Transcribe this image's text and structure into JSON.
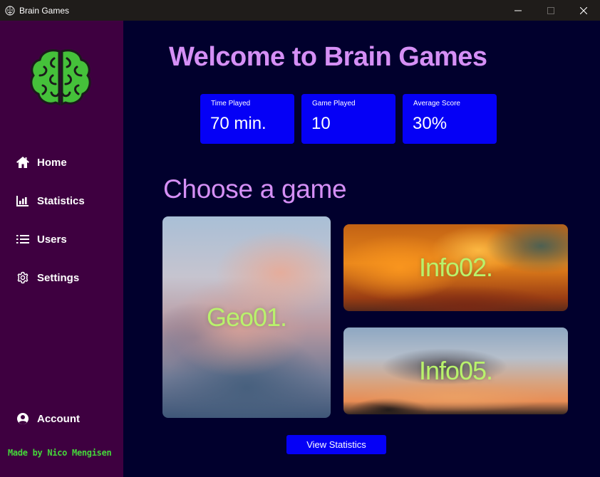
{
  "window": {
    "title": "Brain Games",
    "icons": {
      "app": "brain-app-icon",
      "minimize": "minimize-icon",
      "maximize": "maximize-icon",
      "close": "close-icon"
    }
  },
  "sidebar": {
    "logo": "brain-logo-icon",
    "items": [
      {
        "label": "Home",
        "icon": "home-icon"
      },
      {
        "label": "Statistics",
        "icon": "bar-chart-icon"
      },
      {
        "label": "Users",
        "icon": "list-icon"
      },
      {
        "label": "Settings",
        "icon": "gear-icon"
      }
    ],
    "account": {
      "label": "Account",
      "icon": "user-circle-icon"
    },
    "credits": "Made by Nico Mengisen"
  },
  "main": {
    "welcome": "Welcome to Brain Games",
    "stats": [
      {
        "label": "Time Played",
        "value": "70 min."
      },
      {
        "label": "Game Played",
        "value": "10"
      },
      {
        "label": "Average Score",
        "value": "30%"
      }
    ],
    "choose_title": "Choose a game",
    "games": [
      {
        "label": "Geo01."
      },
      {
        "label": "Info02."
      },
      {
        "label": "Info05."
      }
    ],
    "view_button": "View Statistics"
  },
  "colors": {
    "sidebar_bg": "#3e0040",
    "main_bg": "#01002d",
    "accent_blue": "#0500f6",
    "heading_purple": "#d58ff5",
    "credits_green": "#45d63a",
    "game_label_green": "#b9f26c"
  }
}
